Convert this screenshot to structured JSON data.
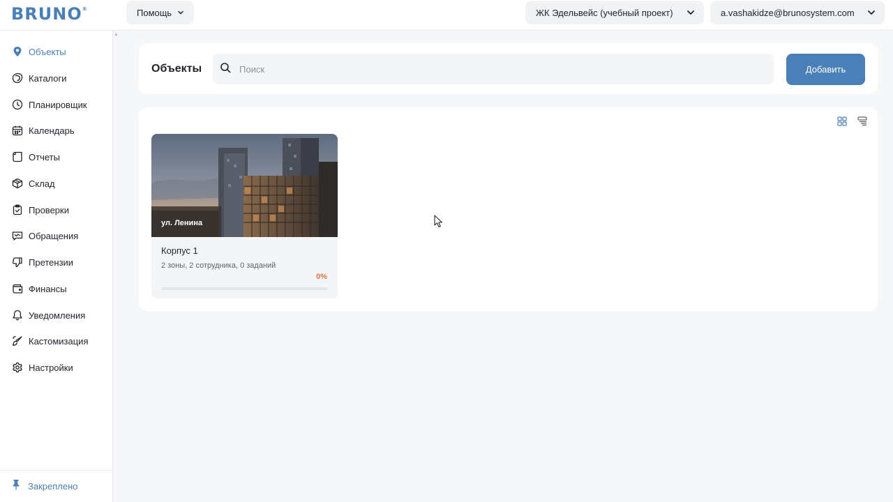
{
  "app": {
    "logo": "BRUNO",
    "logo_mark": "®"
  },
  "header": {
    "help_label": "Помощь",
    "project_label": "ЖК Эдельвейс (учебный проект)",
    "user_label": "a.vashakidze@brunosystem.com"
  },
  "sidebar": {
    "items": [
      {
        "label": "Объекты",
        "icon": "location-pin-icon",
        "active": true
      },
      {
        "label": "Каталоги",
        "icon": "catalog-icon",
        "active": false
      },
      {
        "label": "Планировщик",
        "icon": "clock-icon",
        "active": false
      },
      {
        "label": "Календарь",
        "icon": "calendar-icon",
        "active": false
      },
      {
        "label": "Отчеты",
        "icon": "document-icon",
        "active": false
      },
      {
        "label": "Склад",
        "icon": "box-icon",
        "active": false
      },
      {
        "label": "Проверки",
        "icon": "clipboard-check-icon",
        "active": false
      },
      {
        "label": "Обращения",
        "icon": "message-icon",
        "active": false
      },
      {
        "label": "Претензии",
        "icon": "thumb-down-icon",
        "active": false
      },
      {
        "label": "Финансы",
        "icon": "wallet-icon",
        "active": false
      },
      {
        "label": "Уведомления",
        "icon": "bell-icon",
        "active": false
      },
      {
        "label": "Кастомизация",
        "icon": "brush-icon",
        "active": false
      },
      {
        "label": "Настройки",
        "icon": "gear-icon",
        "active": false
      }
    ],
    "pinned_label": "Закреплено",
    "pinned_icon": "pin-icon"
  },
  "main": {
    "title": "Объекты",
    "search_placeholder": "Поиск",
    "search_value": "",
    "add_button": "Добавить",
    "view_modes": [
      "grid-view-icon",
      "list-view-icon"
    ],
    "cards": [
      {
        "address": "ул. Ленина",
        "title": "Корпус 1",
        "meta": "2 зоны, 2 сотрудника, 0 заданий",
        "percent_label": "0%",
        "progress": 0
      }
    ]
  },
  "colors": {
    "accent": "#4a7fb8",
    "progress": "#e0743b",
    "background": "#f6f7f9"
  }
}
